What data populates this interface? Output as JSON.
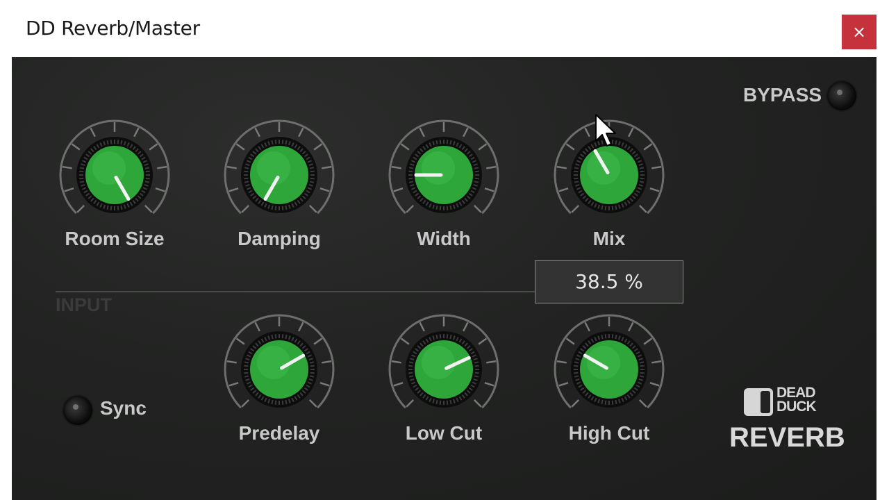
{
  "window": {
    "title": "DD Reverb/Master",
    "close_icon": "close-icon",
    "close_glyph": "×"
  },
  "colors": {
    "knob_green": "#2ea63a",
    "panel_bg": "#222322",
    "close_red": "#c6323c",
    "label_text": "#c9c9c9"
  },
  "knobs_top": [
    {
      "id": "room-size",
      "label": "Room Size",
      "indicator_angle_deg": 150
    },
    {
      "id": "damping",
      "label": "Damping",
      "indicator_angle_deg": -150
    },
    {
      "id": "width",
      "label": "Width",
      "indicator_angle_deg": -90
    },
    {
      "id": "mix",
      "label": "Mix",
      "indicator_angle_deg": -30
    }
  ],
  "knobs_bottom": [
    {
      "id": "predelay",
      "label": "Predelay",
      "indicator_angle_deg": 60
    },
    {
      "id": "low-cut",
      "label": "Low Cut",
      "indicator_angle_deg": 65
    },
    {
      "id": "high-cut",
      "label": "High Cut",
      "indicator_angle_deg": -60
    }
  ],
  "mix_tooltip": {
    "value": "38.5 %"
  },
  "section": {
    "input_label": "INPUT"
  },
  "bypass": {
    "label": "BYPASS"
  },
  "sync": {
    "label": "Sync"
  },
  "logo": {
    "line1": "DEAD",
    "line2": "DUCK",
    "product": "REVERB"
  }
}
